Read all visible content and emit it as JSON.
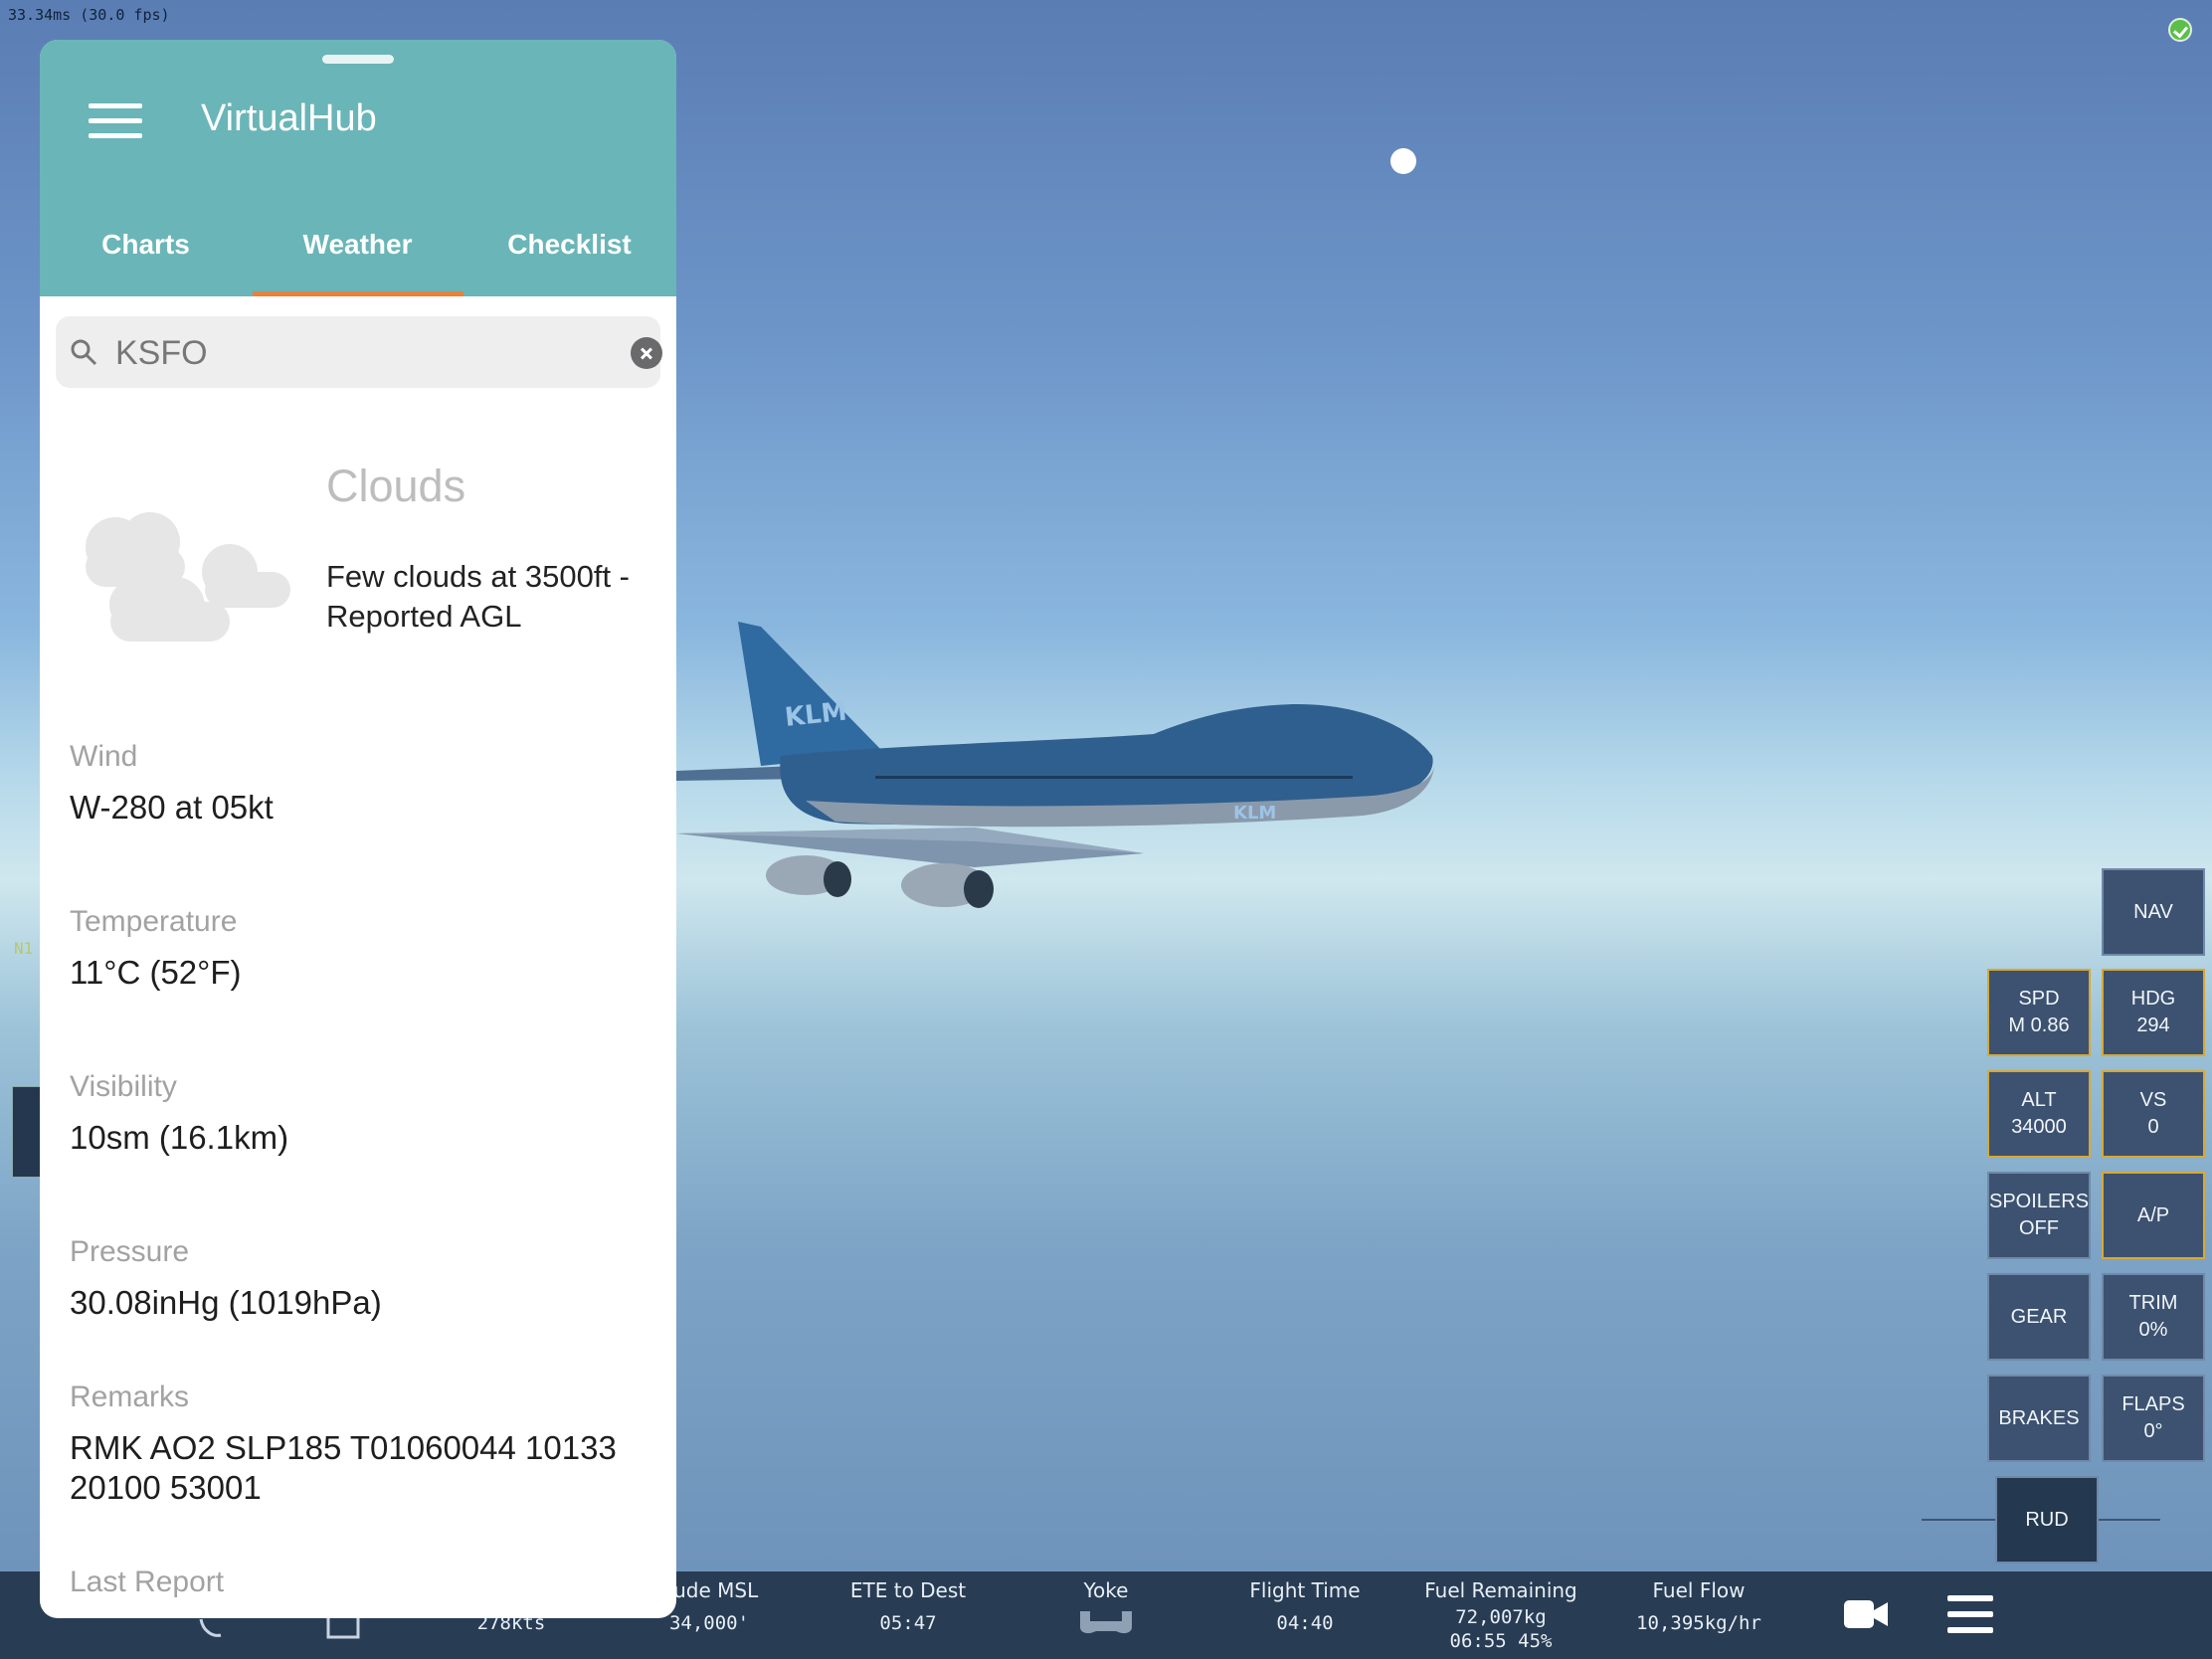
{
  "overlay": {
    "fps_text": "33.34ms (30.0 fps)",
    "side_label": "N1",
    "status_icon": "check-circle-icon"
  },
  "panel": {
    "app_title": "VirtualHub",
    "menu_icon": "hamburger-icon",
    "tabs": [
      {
        "label": "Charts"
      },
      {
        "label": "Weather"
      },
      {
        "label": "Checklist"
      }
    ],
    "active_tab": "Weather",
    "accent_color": "#6ab5b7",
    "tab_indicator_color": "#e8803e",
    "search": {
      "value": "KSFO"
    },
    "weather": {
      "clouds_title": "Clouds",
      "clouds_desc": "Few clouds at 3500ft - Reported AGL",
      "wind_label": "Wind",
      "wind_value": "W-280 at 05kt",
      "temp_label": "Temperature",
      "temp_value": "11°C (52°F)",
      "vis_label": "Visibility",
      "vis_value": "10sm (16.1km)",
      "pressure_label": "Pressure",
      "pressure_value": "30.08inHg (1019hPa)",
      "remarks_label": "Remarks",
      "remarks_value": "RMK AO2 SLP185 T01060044 10133 20100 53001",
      "last_report_label": "Last Report"
    }
  },
  "controls": {
    "nav": "NAV",
    "spd": {
      "label": "SPD",
      "value": "M 0.86"
    },
    "hdg": {
      "label": "HDG",
      "value": "294"
    },
    "alt": {
      "label": "ALT",
      "value": "34000"
    },
    "vs": {
      "label": "VS",
      "value": "0"
    },
    "spoilers": {
      "label": "SPOILERS",
      "value": "OFF"
    },
    "ap": "A/P",
    "gear": "GEAR",
    "trim": {
      "label": "TRIM",
      "value": "0%"
    },
    "brakes": "BRAKES",
    "flaps": {
      "label": "FLAPS",
      "value": "0°"
    },
    "rud": "RUD",
    "active_border_color": "#d8a833"
  },
  "bottom_bar": {
    "ground_speed": "278kts",
    "altitude_label": "itude MSL",
    "altitude_value": "34,000'",
    "ete_label": "ETE to Dest",
    "ete_value": "05:47",
    "yoke_label": "Yoke",
    "flight_time_label": "Flight Time",
    "flight_time_value": "04:40",
    "fuel_remaining_label": "Fuel Remaining",
    "fuel_remaining_value1": "72,007kg",
    "fuel_remaining_value2": "06:55 45%",
    "fuel_flow_label": "Fuel Flow",
    "fuel_flow_value": "10,395kg/hr",
    "camera_icon": "video-camera-icon",
    "menu_icon": "hamburger-icon"
  },
  "scene": {
    "aircraft_livery": "KLM"
  }
}
